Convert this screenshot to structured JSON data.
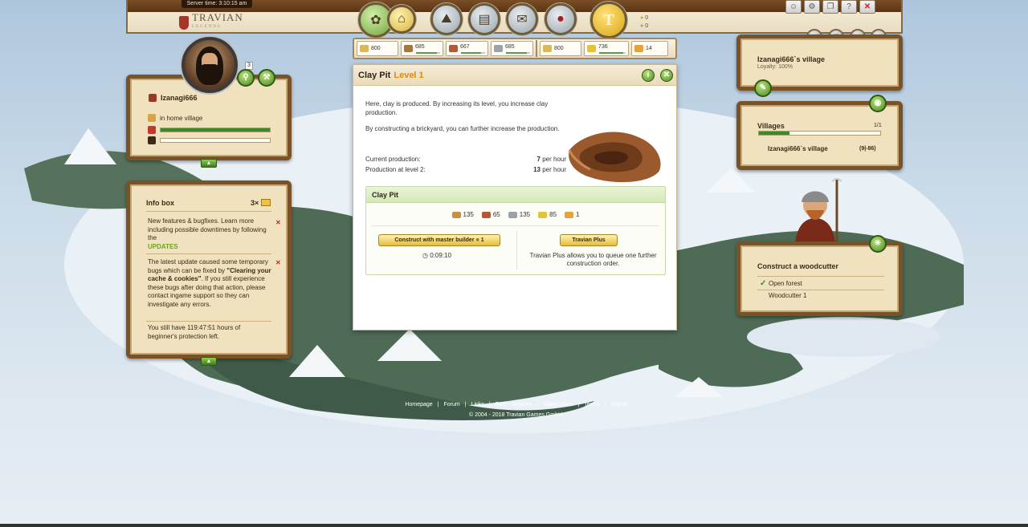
{
  "server_time": {
    "label": "Server time:",
    "value": "3:10:15 am"
  },
  "logo": {
    "title": "TRAVIAN",
    "subtitle": "LEGENDS"
  },
  "nav": {
    "buttons": [
      "resources-icon",
      "village-icon",
      "map-icon",
      "statistics-icon",
      "reports-icon",
      "messages-icon"
    ],
    "gold_label": "T"
  },
  "top_counters": {
    "gold": "0",
    "silver": "0"
  },
  "top_icons": [
    "profile-icon",
    "settings-icon",
    "help-icon",
    "question-icon",
    "logout-icon"
  ],
  "resources": [
    {
      "name": "warehouse",
      "value": "800",
      "color": "#d8b85a"
    },
    {
      "name": "wood",
      "value": "685",
      "color": "#a8743c",
      "fill": 0.86
    },
    {
      "name": "clay",
      "value": "667",
      "color": "#b4583a",
      "fill": 0.83
    },
    {
      "name": "iron",
      "value": "685",
      "color": "#9aa2a8",
      "fill": 0.86
    },
    {
      "name": "granary",
      "value": "800",
      "color": "#d8b85a"
    },
    {
      "name": "crop",
      "value": "736",
      "color": "#e6c23a",
      "fill": 0.92
    },
    {
      "name": "crop-consumption",
      "value": "14",
      "color": "#e6a23a"
    }
  ],
  "player": {
    "name": "Izanagi666",
    "location": "in home village",
    "badge": "3",
    "health": 1.0,
    "experience": 0.0
  },
  "infobox": {
    "title": "Info box",
    "count": "3×",
    "items": [
      {
        "text": "New features & bugfixes. Learn more including possible downtimes by following the",
        "link": "UPDATES"
      },
      {
        "text_before": "The latest update caused some temporary bugs which can be fixed by",
        "bold": "\"Clearing your cache & cookies\"",
        "text_after": ". If you still experience these bugs after doing that action, please contact ingame support so they can investigate any errors."
      },
      {
        "text": "You still have 119:47:51 hours of beginner's protection left."
      }
    ]
  },
  "dialog": {
    "title": "Clay Pit",
    "level": "Level 1",
    "description1": "Here, clay is produced. By increasing its level, you increase clay production.",
    "description2": "By constructing a brickyard, you can further increase the production.",
    "current_production_label": "Current production:",
    "current_production_value": "7",
    "production_next_label": "Production at level 2:",
    "production_next_value": "13",
    "per_hour": "per hour",
    "build": {
      "title": "Clay Pit",
      "costs": [
        {
          "name": "wood",
          "value": "135",
          "color": "#c9913c"
        },
        {
          "name": "clay",
          "value": "65",
          "color": "#b4583a"
        },
        {
          "name": "iron",
          "value": "135",
          "color": "#9aa2a8"
        },
        {
          "name": "crop",
          "value": "85",
          "color": "#e6c23a"
        },
        {
          "name": "crop-consumption",
          "value": "1",
          "color": "#e6a23a"
        }
      ],
      "master_builder_label": "Construct with master builder",
      "master_builder_cost": "1",
      "duration": "0:09:10",
      "plus_label": "Travian Plus",
      "plus_description": "Travian Plus allows you to queue one further construction order."
    }
  },
  "village_panel": {
    "name": "Izanagi666`s village",
    "loyalty": "Loyalty: 100%"
  },
  "villages_panel": {
    "title": "Villages",
    "count": "1/1",
    "village": "Izanagi666`s village",
    "coords": "(9|-86)",
    "fill": 0.3
  },
  "quest_panel": {
    "title": "Construct a woodcutter",
    "tasks": [
      {
        "check": "✓",
        "text": "Open forest"
      },
      {
        "check": "",
        "text": "Woodcutter 1"
      }
    ]
  },
  "footer": {
    "links": [
      "Homepage",
      "Forum",
      "Links",
      "FAQ - Answers",
      "Game rules",
      "Terms",
      "Imprint"
    ],
    "copyright": "© 2004 - 2018 Travian Games GmbH"
  }
}
